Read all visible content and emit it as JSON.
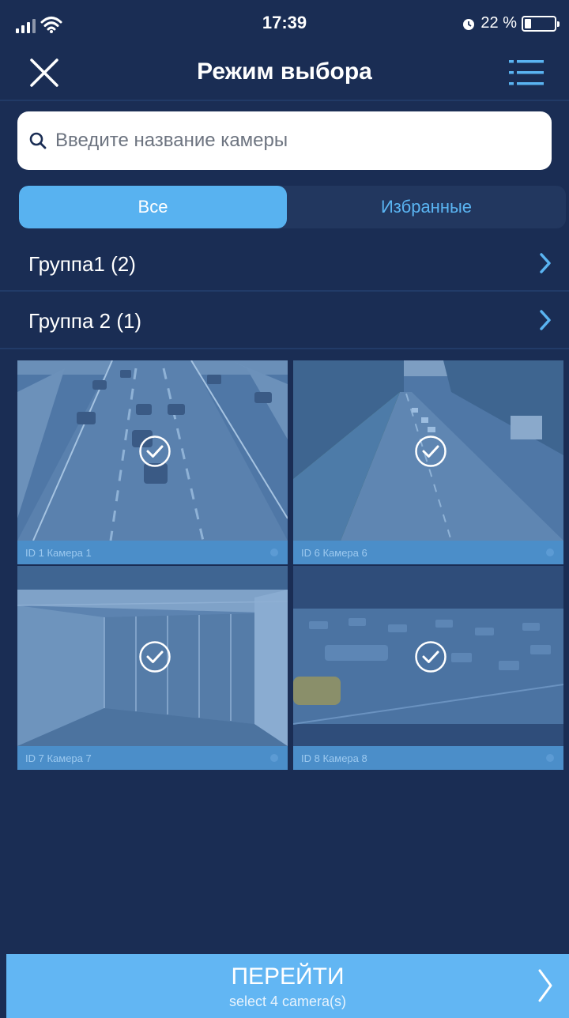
{
  "status_bar": {
    "time": "17:39",
    "battery": "22 %",
    "battery_level": 0.22,
    "icons": [
      "signal-icon",
      "wifi-icon",
      "alarm-icon",
      "battery-icon"
    ]
  },
  "nav": {
    "title": "Режим выбора",
    "close_icon": "close-icon",
    "list_icon": "list-icon"
  },
  "search": {
    "placeholder": "Введите название камеры",
    "value": ""
  },
  "tabs": [
    {
      "label": "Все",
      "active": true
    },
    {
      "label": "Избранные",
      "active": false
    }
  ],
  "groups": [
    {
      "label": "Группа1 (2)"
    },
    {
      "label": "Группа 2 (1)"
    }
  ],
  "cameras": [
    {
      "label": "ID 1 Камера  1",
      "selected": true
    },
    {
      "label": "ID 6 Камера 6",
      "selected": true
    },
    {
      "label": "ID 7 Камера 7",
      "selected": true
    },
    {
      "label": "ID 8 Камера 8",
      "selected": true
    }
  ],
  "go_button": {
    "label": "ПЕРЕЙТИ",
    "sub_label": "select 4 camera(s)"
  },
  "colors": {
    "background": "#1a2d54",
    "accent": "#58b2f0",
    "button": "#62b6f3",
    "caption": "#4b8ec9"
  }
}
